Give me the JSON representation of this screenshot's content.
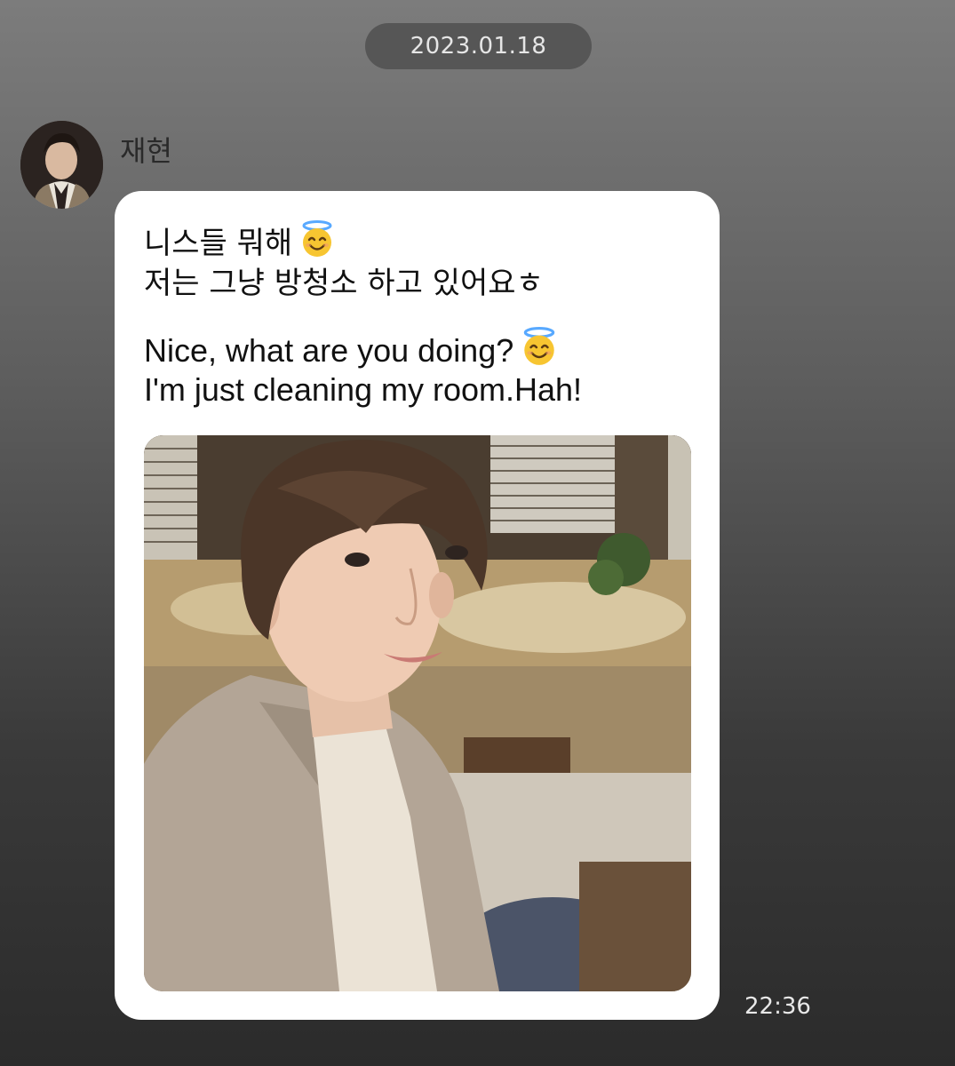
{
  "chat": {
    "date": "2023.01.18",
    "sender": {
      "name": "재현",
      "avatar_icon": "profile-photo"
    },
    "message": {
      "korean_line_1": "니스들 뭐해",
      "korean_line_2": "저는 그냥 방청소 하고 있어요ㅎ",
      "english_line_1": "Nice, what are you doing?",
      "english_line_2": "I'm just cleaning my room.Hah!",
      "emoji": "smiling-face-with-halo",
      "photo_icon": "selfie-photo"
    },
    "time": "22:36"
  },
  "colors": {
    "bubble": "#ffffff",
    "pill": "#4b4b4b",
    "background_top": "#7c7c7c",
    "background_bottom": "#2b2b2b"
  }
}
